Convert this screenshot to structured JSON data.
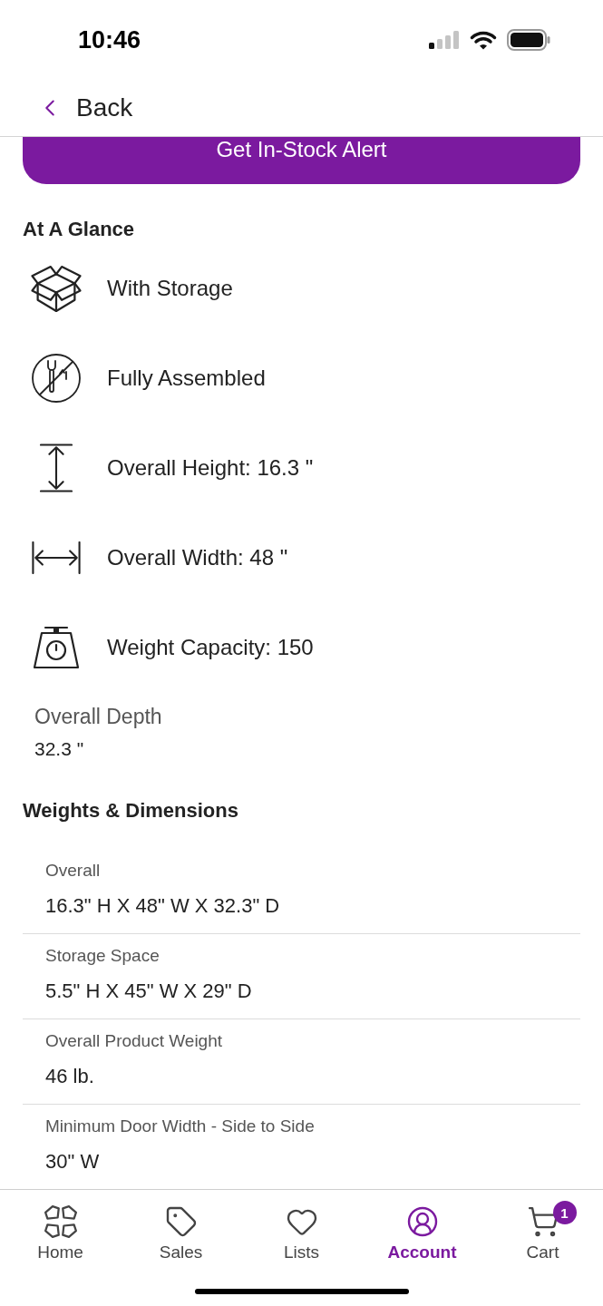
{
  "status_bar": {
    "time": "10:46"
  },
  "nav": {
    "back_label": "Back"
  },
  "alert_button": {
    "label": "Get In-Stock Alert"
  },
  "at_a_glance": {
    "title": "At A Glance",
    "items": [
      {
        "label": "With Storage"
      },
      {
        "label": "Fully Assembled"
      },
      {
        "label": "Overall Height: 16.3 \""
      },
      {
        "label": "Overall Width: 48 \""
      },
      {
        "label": "Weight Capacity: 150"
      }
    ],
    "depth": {
      "label": "Overall Depth",
      "value": "32.3 \""
    }
  },
  "weights_dimensions": {
    "title": "Weights & Dimensions",
    "rows": [
      {
        "label": "Overall",
        "value": "16.3\" H X 48\" W X 32.3\" D"
      },
      {
        "label": "Storage Space",
        "value": "5.5\" H X 45\" W X 29\" D"
      },
      {
        "label": "Overall Product Weight",
        "value": "46 lb."
      },
      {
        "label": "Minimum Door Width - Side to Side",
        "value": "30\" W"
      }
    ]
  },
  "tabs": [
    {
      "label": "Home",
      "selected": false
    },
    {
      "label": "Sales",
      "selected": false
    },
    {
      "label": "Lists",
      "selected": false
    },
    {
      "label": "Account",
      "selected": true
    },
    {
      "label": "Cart",
      "selected": false,
      "badge": "1"
    }
  ]
}
